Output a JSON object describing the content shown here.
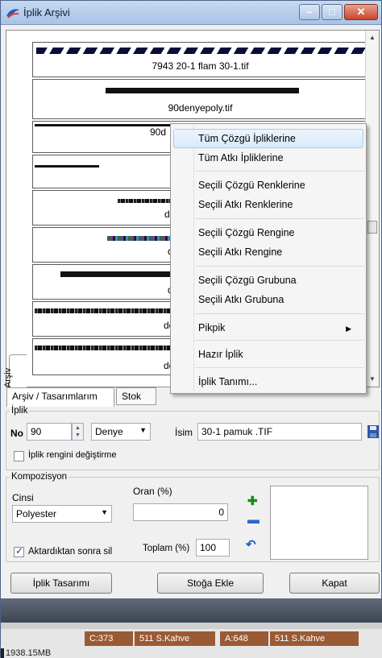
{
  "window": {
    "title": "İplik Arşivi"
  },
  "yarn_list": {
    "items": [
      {
        "label": "7943 20-1 flam 30-1.tif"
      },
      {
        "label": "90denyepoly.tif"
      },
      {
        "label": "90d"
      },
      {
        "label": ""
      },
      {
        "label": "de"
      },
      {
        "label": "d"
      },
      {
        "label": "d"
      },
      {
        "label": "de"
      },
      {
        "label": "de"
      }
    ],
    "side_tab": "Arşiv"
  },
  "context_menu": {
    "items": [
      "Tüm Çözgü İpliklerine",
      "Tüm Atkı İpliklerine",
      "Seçili Çözgü Renklerine",
      "Seçili Atkı Renklerine",
      "Seçili Çözgü Rengine",
      "Seçili Atkı Rengine",
      "Seçili Çözgü Grubuna",
      "Seçili Atkı Grubuna",
      "Pikpik",
      "Hazır İplik",
      "İplik Tanımı..."
    ],
    "highlighted": "Tüm Çözgü İpliklerine"
  },
  "tabs": [
    "Arşiv / Tasarımlarım",
    "Stok"
  ],
  "iplik": {
    "legend": "İplik",
    "no_label": "No",
    "no_value": "90",
    "unit_value": "Denye",
    "isim_label": "İsim",
    "isim_value": "30-1 pamuk .TIF",
    "color_checkbox_label": "İplik rengini değiştirme"
  },
  "kompozisyon": {
    "legend": "Kompozisyon",
    "cinsi_label": "Cinsi",
    "cinsi_value": "Polyester",
    "oran_label": "Oran (%)",
    "oran_value": "0",
    "toplam_label": "Toplam (%)",
    "toplam_value": "100",
    "delete_after_label": "Aktardıktan sonra sil",
    "delete_after_checked": true
  },
  "buttons": {
    "design": "İplik Tasarımı",
    "add_stock": "Stoğa Ekle",
    "close": "Kapat"
  },
  "status": {
    "cells": [
      "C:373",
      "511 S.Kahve",
      "A:648",
      "511 S.Kahve"
    ],
    "memory": "1938.15MB"
  }
}
